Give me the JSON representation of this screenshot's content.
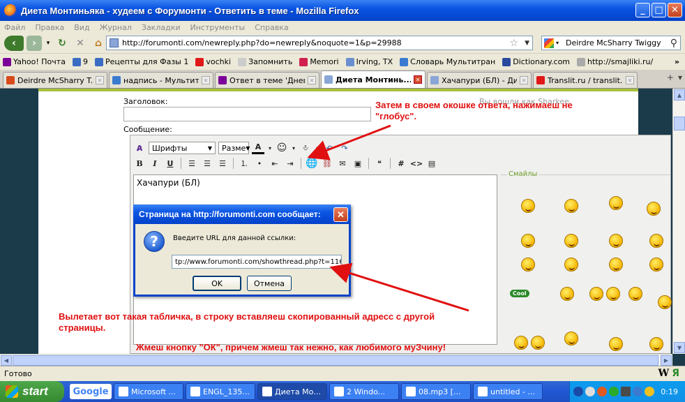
{
  "window": {
    "title": "Диета Монтиньяка - худеем с Форумонти - Ответить в теме - Mozilla Firefox"
  },
  "menu": [
    "Файл",
    "Правка",
    "Вид",
    "Журнал",
    "Закладки",
    "Инструменты",
    "Справка"
  ],
  "nav": {
    "url": "http://forumonti.com/newreply.php?do=newreply&noquote=1&p=29988",
    "search_value": "Deirdre McSharry Twiggy"
  },
  "bookmarks": [
    {
      "label": "Yahoo! Почта",
      "color": "#7b0099"
    },
    {
      "label": "9",
      "color": "#3b6cc4"
    },
    {
      "label": "Рецепты для Фазы 1",
      "color": "#3b6cc4"
    },
    {
      "label": "vochki",
      "color": "#e01818"
    },
    {
      "label": "Запомнить",
      "color": "#ccc"
    },
    {
      "label": "Memori",
      "color": "#d02050"
    },
    {
      "label": "Irving, TX",
      "color": "#6a8fd0"
    },
    {
      "label": "Словарь Мультитран",
      "color": "#3a7ad0"
    },
    {
      "label": "Dictionary.com",
      "color": "#2a4aa0"
    },
    {
      "label": "http://smajliki.ru/",
      "color": "#aaa"
    }
  ],
  "tabs": [
    {
      "label": "Deirdre McSharry T...",
      "active": false
    },
    {
      "label": "надпись - Мультит...",
      "active": false
    },
    {
      "label": "Ответ в теме 'Днев...",
      "active": false
    },
    {
      "label": "Диета Монтинь...",
      "active": true
    },
    {
      "label": "Хачапури (БЛ) - Ди...",
      "active": false
    },
    {
      "label": "Translit.ru / translit...",
      "active": false
    }
  ],
  "form": {
    "subject_label": "Заголовок:",
    "message_label": "Сообщение:",
    "logged_as": "Вы вошли как Sharkee",
    "font_select": "Шрифты",
    "size_select": "Разме",
    "message_text": "Хачапури (БЛ)",
    "smileys_label": "Смайлы",
    "smiley_caption": "Cool"
  },
  "dialog": {
    "title": "Страница на http://forumonti.com сообщает:",
    "prompt": "Введите URL для данной ссылки:",
    "input_value": "tp://www.forumonti.com/showthread.php?t=1168",
    "ok_label": "OK",
    "cancel_label": "Отмена"
  },
  "annotations": {
    "top": "Затем в своем окошке ответа, нажимаеш не \"глобус\".",
    "middle": "Вылетает вот такая табличка, в строку вставляеш скопированный адресс с другой страницы.",
    "bottom": "Жмеш кнопку \"ОК\", причем жмеш так нежно, как любимого муЗчину!"
  },
  "status": {
    "text": "Готово"
  },
  "taskbar": {
    "start": "start",
    "google": "Google",
    "items": [
      {
        "label": "Microsoft ...",
        "active": false
      },
      {
        "label": "ENGL_135...",
        "active": false
      },
      {
        "label": "Диета Мо...",
        "active": true
      },
      {
        "label": "2 Windo...",
        "active": false
      },
      {
        "label": "08.mp3 [...",
        "active": false
      },
      {
        "label": "untitled - ...",
        "active": false
      }
    ],
    "clock": "0:19"
  },
  "colors": {
    "annotation": "#e01010",
    "xp_blue": "#0a54e3",
    "forum_green": "#a8c03e",
    "page_bg": "#1b3a4a"
  }
}
